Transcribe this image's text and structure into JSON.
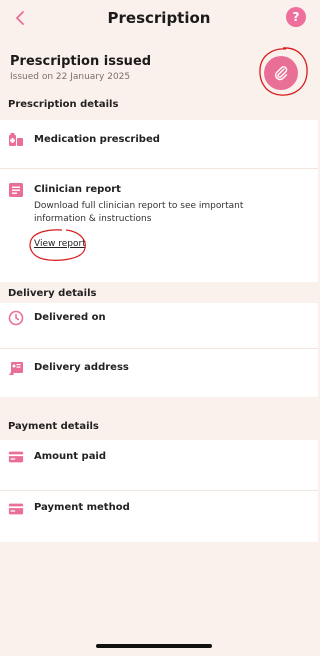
{
  "header": {
    "title": "Prescription",
    "back_icon": "chevron-left-icon",
    "help_icon": "question-icon"
  },
  "prescription": {
    "title": "Prescription issued",
    "issued_on": "Issued on 22 January 2025",
    "attach_icon": "paperclip-icon"
  },
  "sections": {
    "prescription_details": "Prescription details",
    "delivery_details": "Delivery details",
    "payment_details": "Payment details"
  },
  "rows": {
    "medication": {
      "label": "Medication prescribed",
      "icon": "medication-icon"
    },
    "clinician_report": {
      "label": "Clinician report",
      "description": "Download full clinician report to see important information & instructions",
      "link": "View report",
      "icon": "document-icon"
    },
    "delivered_on": {
      "label": "Delivered on",
      "icon": "clock-icon"
    },
    "delivery_address": {
      "label": "Delivery address",
      "icon": "address-icon"
    },
    "amount_paid": {
      "label": "Amount paid",
      "icon": "card-icon"
    },
    "payment_method": {
      "label": "Payment method",
      "icon": "card-icon"
    }
  },
  "colors": {
    "accent": "#ea6f97",
    "background": "#fbf1ec",
    "card": "#ffffff",
    "annotation": "#d81b1b"
  }
}
